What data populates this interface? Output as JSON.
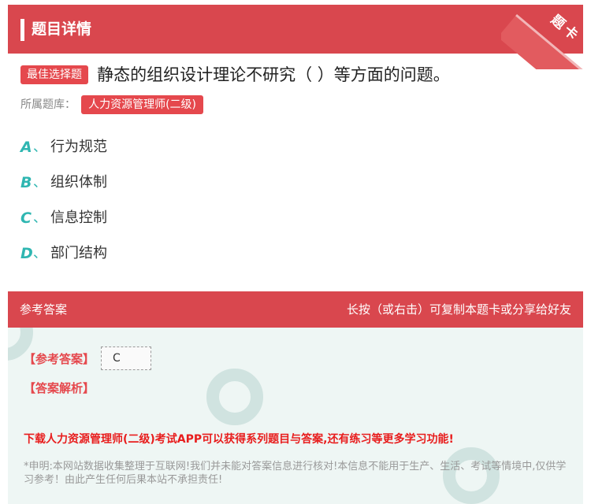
{
  "header": {
    "title": "题目详情",
    "corner_label": "题卡"
  },
  "question": {
    "type_badge": "最佳选择题",
    "text": "静态的组织设计理论不研究（ ）等方面的问题。",
    "bank_label": "所属题库：",
    "bank_tag": "人力资源管理师(二级)"
  },
  "options": [
    {
      "letter": "A",
      "sep": "、",
      "text": "行为规范"
    },
    {
      "letter": "B",
      "sep": "、",
      "text": "组织体制"
    },
    {
      "letter": "C",
      "sep": "、",
      "text": "信息控制"
    },
    {
      "letter": "D",
      "sep": "、",
      "text": "部门结构"
    }
  ],
  "answer": {
    "section_title": "参考答案",
    "hint": "长按（或右击）可复制本题卡或分享给好友",
    "ref_label": "【参考答案】",
    "ref_value": "C",
    "analysis_label": "【答案解析】",
    "promo": "下载人力资源管理师(二级)考试APP可以获得系列题目与答案,还有练习等更多学习功能!",
    "disclaimer": "*申明:本网站数据收集整理于互联网!我们并未能对答案信息进行核对!本信息不能用于生产、生活、考试等情境中,仅供学习参考！由此产生任何后果本站不承担责任!"
  },
  "colors": {
    "accent_red": "#d9474e",
    "option_teal": "#2fb6b1",
    "answer_bg": "#eef6f4",
    "promo_red": "#e81d1d"
  }
}
